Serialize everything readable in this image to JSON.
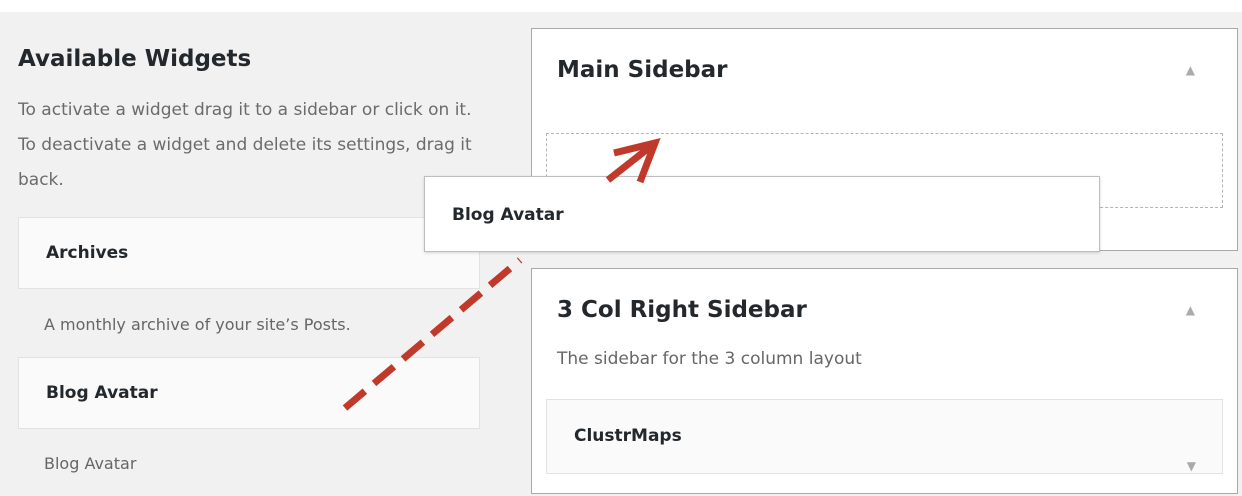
{
  "available": {
    "title": "Available Widgets",
    "description": "To activate a widget drag it to a sidebar or click on it. To deactivate a widget and delete its settings, drag it back.",
    "widgets": [
      {
        "label": "Archives",
        "description": "A monthly archive of your site’s Posts."
      },
      {
        "label": "Blog Avatar",
        "description": "Blog Avatar"
      }
    ]
  },
  "dragging_widget": {
    "label": "Blog Avatar"
  },
  "sidebars": [
    {
      "title": "Main Sidebar",
      "toggle_icon": "▲"
    },
    {
      "title": "3 Col Right Sidebar",
      "description": "The sidebar for the 3 column layout",
      "toggle_icon": "▲",
      "widgets": [
        {
          "label": "ClustrMaps",
          "toggle_icon": "▼"
        }
      ]
    }
  ],
  "colors": {
    "annotation_arrow": "#c0392b",
    "panel_background": "#f1f1f1"
  }
}
